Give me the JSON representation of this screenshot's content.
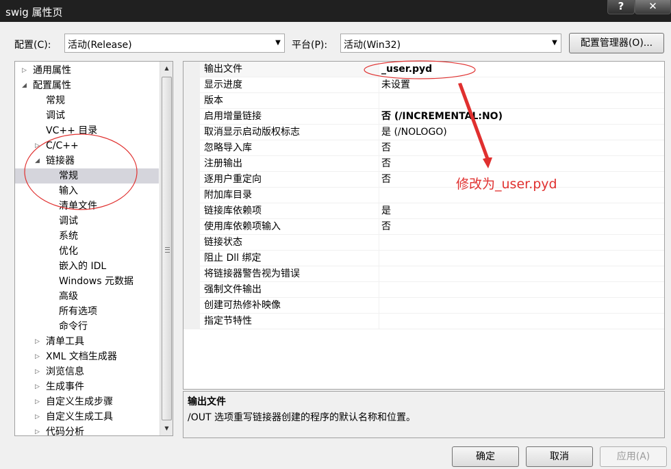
{
  "window": {
    "title": "swig 属性页",
    "help_label": "?",
    "close_label": "✕"
  },
  "config": {
    "label": "配置(C):",
    "value": "活动(Release)",
    "platform_label": "平台(P):",
    "platform_value": "活动(Win32)",
    "manager_label": "配置管理器(O)..."
  },
  "tree": {
    "items": [
      {
        "label": "通用属性",
        "level": 0,
        "expander": "▷"
      },
      {
        "label": "配置属性",
        "level": 0,
        "expander": "◢"
      },
      {
        "label": "常规",
        "level": 1,
        "expander": ""
      },
      {
        "label": "调试",
        "level": 1,
        "expander": ""
      },
      {
        "label": "VC++ 目录",
        "level": 1,
        "expander": ""
      },
      {
        "label": "C/C++",
        "level": 1,
        "expander": "▷"
      },
      {
        "label": "链接器",
        "level": 1,
        "expander": "◢"
      },
      {
        "label": "常规",
        "level": 2,
        "expander": "",
        "selected": true
      },
      {
        "label": "输入",
        "level": 2,
        "expander": ""
      },
      {
        "label": "清单文件",
        "level": 2,
        "expander": ""
      },
      {
        "label": "调试",
        "level": 2,
        "expander": ""
      },
      {
        "label": "系统",
        "level": 2,
        "expander": ""
      },
      {
        "label": "优化",
        "level": 2,
        "expander": ""
      },
      {
        "label": "嵌入的 IDL",
        "level": 2,
        "expander": ""
      },
      {
        "label": "Windows 元数据",
        "level": 2,
        "expander": ""
      },
      {
        "label": "高级",
        "level": 2,
        "expander": ""
      },
      {
        "label": "所有选项",
        "level": 2,
        "expander": ""
      },
      {
        "label": "命令行",
        "level": 2,
        "expander": ""
      },
      {
        "label": "清单工具",
        "level": 1,
        "expander": "▷"
      },
      {
        "label": "XML 文档生成器",
        "level": 1,
        "expander": "▷"
      },
      {
        "label": "浏览信息",
        "level": 1,
        "expander": "▷"
      },
      {
        "label": "生成事件",
        "level": 1,
        "expander": "▷"
      },
      {
        "label": "自定义生成步骤",
        "level": 1,
        "expander": "▷"
      },
      {
        "label": "自定义生成工具",
        "level": 1,
        "expander": "▷"
      },
      {
        "label": "代码分析",
        "level": 1,
        "expander": "▷"
      }
    ]
  },
  "properties": [
    {
      "name": "输出文件",
      "value": "_user.pyd",
      "bold": true
    },
    {
      "name": "显示进度",
      "value": "未设置",
      "bold": false
    },
    {
      "name": "版本",
      "value": "",
      "bold": false
    },
    {
      "name": "启用增量链接",
      "value": "否 (/INCREMENTAL:NO)",
      "bold": true
    },
    {
      "name": "取消显示启动版权标志",
      "value": "是 (/NOLOGO)",
      "bold": false
    },
    {
      "name": "忽略导入库",
      "value": "否",
      "bold": false
    },
    {
      "name": "注册输出",
      "value": "否",
      "bold": false
    },
    {
      "name": "逐用户重定向",
      "value": "否",
      "bold": false
    },
    {
      "name": "附加库目录",
      "value": "",
      "bold": false
    },
    {
      "name": "链接库依赖项",
      "value": "是",
      "bold": false
    },
    {
      "name": "使用库依赖项输入",
      "value": "否",
      "bold": false
    },
    {
      "name": "链接状态",
      "value": "",
      "bold": false
    },
    {
      "name": "阻止 Dll 绑定",
      "value": "",
      "bold": false
    },
    {
      "name": "将链接器警告视为错误",
      "value": "",
      "bold": false
    },
    {
      "name": "强制文件输出",
      "value": "",
      "bold": false
    },
    {
      "name": "创建可热修补映像",
      "value": "",
      "bold": false
    },
    {
      "name": "指定节特性",
      "value": "",
      "bold": false
    }
  ],
  "description": {
    "title": "输出文件",
    "text": "/OUT 选项重写链接器创建的程序的默认名称和位置。"
  },
  "buttons": {
    "ok": "确定",
    "cancel": "取消",
    "apply": "应用(A)"
  },
  "annotation": {
    "text": "修改为_user.pyd",
    "color": "#e0302f"
  }
}
